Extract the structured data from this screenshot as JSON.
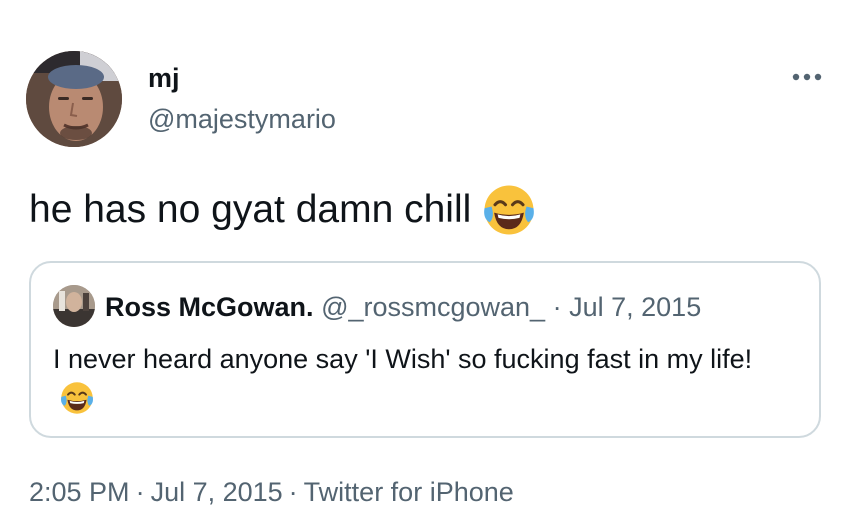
{
  "author": {
    "display_name": "mj",
    "handle": "@majestymario",
    "avatar_icon": "profile-photo"
  },
  "more_icon": "ellipsis-icon",
  "tweet": {
    "text": "he has no gyat damn chill",
    "emoji": "face-with-tears-of-joy"
  },
  "quoted": {
    "display_name": "Ross McGowan.",
    "handle": "@_rossmcgowan_",
    "separator": "·",
    "date": "Jul 7, 2015",
    "text": "I never heard anyone say 'I Wish' so fucking fast in my life!",
    "emoji": "face-with-tears-of-joy"
  },
  "footer": {
    "time": "2:05 PM",
    "separator": "·",
    "date": "Jul 7, 2015",
    "source": "Twitter for iPhone"
  },
  "colors": {
    "text_primary": "#0f1419",
    "text_secondary": "#536471",
    "border": "#cfd9de",
    "emoji_yellow": "#f9c23c",
    "emoji_tears": "#5ab0e8"
  }
}
